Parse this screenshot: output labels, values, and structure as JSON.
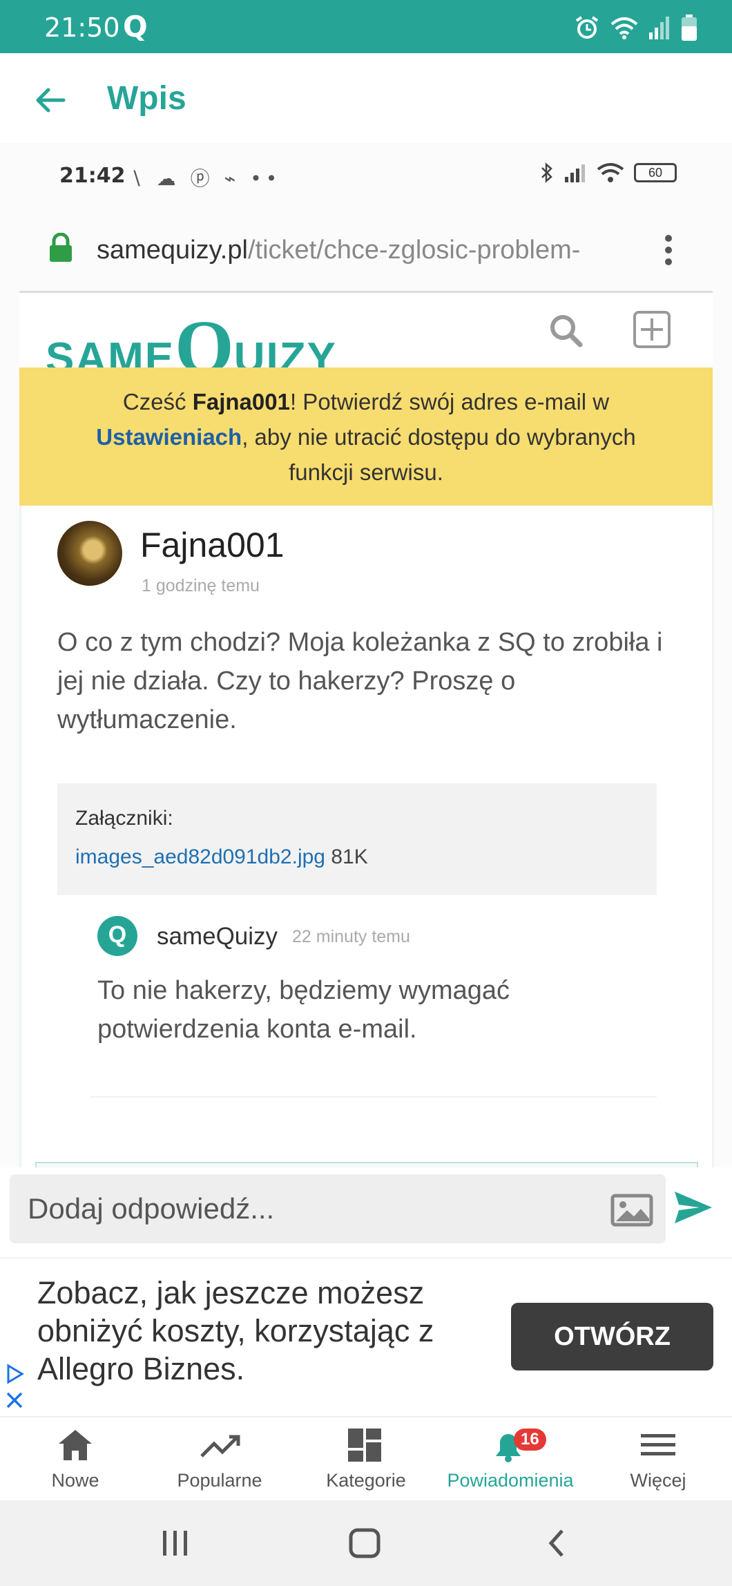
{
  "status_bar": {
    "time": "21:50",
    "app_glyph": "Q",
    "bg_color": "#26a597"
  },
  "app_bar": {
    "title": "Wpis"
  },
  "inner_screenshot": {
    "status_time": "21:42",
    "status_icons": "∖ ☁ ⓟ ⌁ ••",
    "battery": "60",
    "url_domain": "samequizy.pl",
    "url_path": "/ticket/chce-zglosic-problem-",
    "logo_small": "SAME",
    "logo_big": "Q",
    "logo_rest": "UIZY",
    "banner": {
      "greeting": "Cześć ",
      "username": "Fajna001",
      "line1_rest": "! Potwierdź swój adres e-mail w",
      "link": "Ustawieniach",
      "line2_rest": ", aby nie utracić dostępu do wybranych",
      "line3": "funkcji serwisu."
    },
    "post": {
      "author": "Fajna001",
      "time": "1 godzinę temu",
      "text": "O co z tym chodzi? Moja koleżanka z SQ to zrobiła i jej nie działa. Czy to hakerzy? Proszę o wytłumaczenie.",
      "attachments_label": "Załączniki:",
      "attachment_file": "images_aed82d091db2.jpg",
      "attachment_size": "81K"
    },
    "reply": {
      "icon_letter": "Q",
      "author": "sameQuizy",
      "time": "22 minuty temu",
      "text": "To nie hakerzy, będziemy wymagać potwierdzenia konta e-mail."
    }
  },
  "reply_input": {
    "placeholder": "Dodaj odpowiedź..."
  },
  "ad": {
    "text": "Zobacz, jak jeszcze możesz obniżyć koszty, korzystając z Allegro Biznes.",
    "button": "OTWÓRZ"
  },
  "bottom_nav": {
    "items": [
      {
        "label": "Nowe",
        "icon": "home-icon"
      },
      {
        "label": "Popularne",
        "icon": "trending-icon"
      },
      {
        "label": "Kategorie",
        "icon": "dashboard-icon"
      },
      {
        "label": "Powiadomienia",
        "icon": "bell-icon",
        "badge": "16",
        "active": true
      },
      {
        "label": "Więcej",
        "icon": "menu-icon"
      }
    ]
  },
  "colors": {
    "accent": "#26a597",
    "banner": "#f7dc6f",
    "badge": "#e53935"
  }
}
